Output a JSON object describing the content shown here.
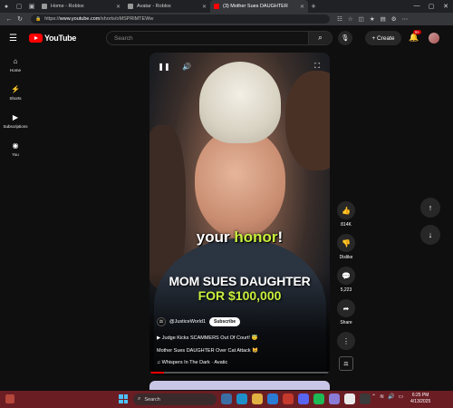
{
  "browser": {
    "tabs": [
      {
        "label": "Home - Roblox",
        "active": false
      },
      {
        "label": "Avatar - Roblox",
        "active": false
      },
      {
        "label": "(3) Mother Sues DAUGHTER",
        "active": true
      }
    ],
    "url_prefix": "https://",
    "url_domain": "www.youtube.com",
    "url_path": "/shorts/oMSPRlMTEWw"
  },
  "youtube": {
    "logo_text": "YouTube",
    "search_placeholder": "Search",
    "create_label": "+ Create",
    "notif_count": "9+",
    "nav": [
      {
        "label": "Home",
        "icon": "home-icon"
      },
      {
        "label": "Shorts",
        "icon": "shorts-icon"
      },
      {
        "label": "Subscriptions",
        "icon": "subscriptions-icon"
      },
      {
        "label": "You",
        "icon": "you-icon"
      }
    ]
  },
  "video": {
    "caption_part1": "your ",
    "caption_highlight": "honor",
    "caption_part2": "!",
    "headline_line1": "MOM SUES DAUGHTER",
    "headline_line2": "FOR $100,000",
    "channel_name": "@JusticeWorld1",
    "subscribe_label": "Subscribe",
    "related_link": "Judge Kicks SCAMMERS Out Of Court! 😇",
    "title": "Mother Sues DAUGHTER Over Cat Attack 😸",
    "music": "Whispers In The Dark · Avatic",
    "progress": 0.08
  },
  "actions": {
    "likes": "814K",
    "dislike_label": "Dislike",
    "comments": "5,223",
    "share_label": "Share"
  },
  "taskbar": {
    "search_placeholder": "Search",
    "time": "6:25 PM",
    "date": "4/13/2025"
  },
  "colors": {
    "accent_red": "#ff0000",
    "highlight_green": "#c8f03c",
    "taskbar": "#6b1d24"
  }
}
